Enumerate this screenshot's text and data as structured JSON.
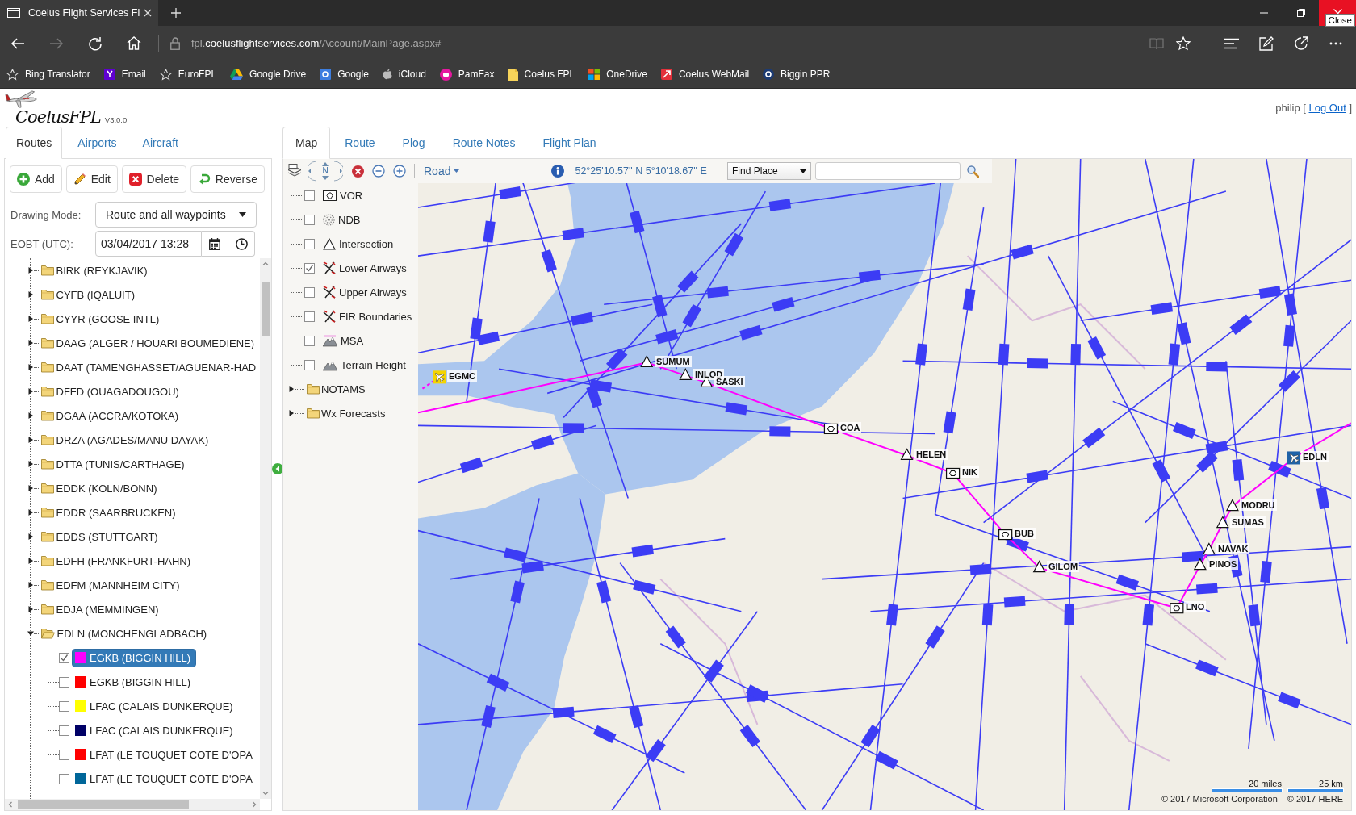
{
  "browser": {
    "tab_title": "Coelus Flight Services Fl",
    "tooltip": "Close",
    "url": "fpl.**coelusflightservices.com**/Account/MainPage.aspx#"
  },
  "favorites": [
    "Bing Translator",
    "Email",
    "EuroFPL",
    "Google Drive",
    "Google",
    "iCloud",
    "PamFax",
    "Coelus FPL",
    "OneDrive",
    "Coelus WebMail",
    "Biggin PPR"
  ],
  "app": {
    "logo": "CoelusFPL",
    "version": "V3.0.0",
    "user": {
      "before": "philip [",
      "link": "Log Out",
      "after": "]"
    }
  },
  "left_panel": {
    "tabs": [
      {
        "label": "Routes",
        "selected": true
      },
      {
        "label": "Airports",
        "selected": false
      },
      {
        "label": "Aircraft",
        "selected": false
      }
    ],
    "buttons": [
      "Add",
      "Edit",
      "Delete",
      "Reverse"
    ],
    "drawing_mode": {
      "label": "Drawing Mode:",
      "value": "Route and all waypoints"
    },
    "eobt": {
      "label": "EOBT (UTC):",
      "value": "03/04/2017 13:28"
    },
    "tree": [
      {
        "label": "BIRK (REYKJAVIK)",
        "expanded": false
      },
      {
        "label": "CYFB (IQALUIT)",
        "expanded": false
      },
      {
        "label": "CYYR (GOOSE INTL)",
        "expanded": false
      },
      {
        "label": "DAAG (ALGER / HOUARI BOUMEDIENE)",
        "expanded": false
      },
      {
        "label": "DAAT (TAMENGHASSET/AGUENAR-HAD",
        "expanded": false
      },
      {
        "label": "DFFD (OUAGADOUGOU)",
        "expanded": false
      },
      {
        "label": "DGAA (ACCRA/KOTOKA)",
        "expanded": false
      },
      {
        "label": "DRZA (AGADES/MANU DAYAK)",
        "expanded": false
      },
      {
        "label": "DTTA (TUNIS/CARTHAGE)",
        "expanded": false
      },
      {
        "label": "EDDK (KOLN/BONN)",
        "expanded": false
      },
      {
        "label": "EDDR (SAARBRUCKEN)",
        "expanded": false
      },
      {
        "label": "EDDS (STUTTGART)",
        "expanded": false
      },
      {
        "label": "EDFH (FRANKFURT-HAHN)",
        "expanded": false
      },
      {
        "label": "EDFM (MANNHEIM CITY)",
        "expanded": false
      },
      {
        "label": "EDJA (MEMMINGEN)",
        "expanded": false
      },
      {
        "label": "EDLN (MONCHENGLADBACH)",
        "expanded": true,
        "children": [
          {
            "label": "EGKB (BIGGIN HILL)",
            "color": "#ff00ff",
            "checked": true,
            "selected": true
          },
          {
            "label": "EGKB (BIGGIN HILL)",
            "color": "#ff0000",
            "checked": false,
            "selected": false
          },
          {
            "label": "LFAC (CALAIS DUNKERQUE)",
            "color": "#ffff00",
            "checked": false,
            "selected": false
          },
          {
            "label": "LFAC (CALAIS DUNKERQUE)",
            "color": "#000066",
            "checked": false,
            "selected": false
          },
          {
            "label": "LFAT (LE TOUQUET COTE D'OPA",
            "color": "#ff0000",
            "checked": false,
            "selected": false
          },
          {
            "label": "LFAT (LE TOUQUET COTE D'OPA",
            "color": "#006699",
            "checked": false,
            "selected": false
          }
        ]
      }
    ]
  },
  "right_panel": {
    "tabs": [
      {
        "label": "Map",
        "selected": true
      },
      {
        "label": "Route",
        "selected": false
      },
      {
        "label": "Plog",
        "selected": false
      },
      {
        "label": "Route Notes",
        "selected": false
      },
      {
        "label": "Flight Plan",
        "selected": false
      }
    ],
    "toolbar": {
      "compass": "N",
      "map_style": "Road",
      "coordinates": "52°25'10.57'' N 5°10'18.67'' E",
      "find_place": "Find Place"
    },
    "layers": [
      {
        "kind": "layer",
        "label": "VOR",
        "checked": false
      },
      {
        "kind": "layer",
        "label": "NDB",
        "checked": false
      },
      {
        "kind": "layer",
        "label": "Intersection",
        "checked": false
      },
      {
        "kind": "layer",
        "label": "Lower Airways",
        "checked": true
      },
      {
        "kind": "layer",
        "label": "Upper Airways",
        "checked": false
      },
      {
        "kind": "layer",
        "label": "FIR Boundaries",
        "checked": false
      },
      {
        "kind": "layer",
        "label": "MSA",
        "checked": false
      },
      {
        "kind": "layer",
        "label": "Terrain Height",
        "checked": false
      },
      {
        "kind": "folder",
        "label": "NOTAMS",
        "expanded": false
      },
      {
        "kind": "folder",
        "label": "Wx Forecasts",
        "expanded": false
      }
    ],
    "map": {
      "waypoints": [
        {
          "label": "SUMUM",
          "kind": "intersection"
        },
        {
          "label": "INLOD",
          "kind": "intersection"
        },
        {
          "label": "EGMC",
          "kind": "airport",
          "color": "#f5d400"
        },
        {
          "label": "SASKI",
          "kind": "intersection"
        },
        {
          "label": "COA",
          "kind": "vor"
        },
        {
          "label": "HELEN",
          "kind": "intersection"
        },
        {
          "label": "EDLN",
          "kind": "airport",
          "color": "#1f62a8"
        },
        {
          "label": "NIK",
          "kind": "vor"
        },
        {
          "label": "MODRU",
          "kind": "intersection"
        },
        {
          "label": "SUMAS",
          "kind": "intersection"
        },
        {
          "label": "BUB",
          "kind": "vor"
        },
        {
          "label": "NAVAK",
          "kind": "intersection"
        },
        {
          "label": "PINOS",
          "kind": "intersection"
        },
        {
          "label": "GILOM",
          "kind": "intersection"
        },
        {
          "label": "LNO",
          "kind": "vor"
        }
      ],
      "scale": [
        "20 miles",
        "25 km"
      ],
      "copyright": [
        "© 2017 Microsoft Corporation",
        "© 2017 HERE"
      ]
    }
  }
}
